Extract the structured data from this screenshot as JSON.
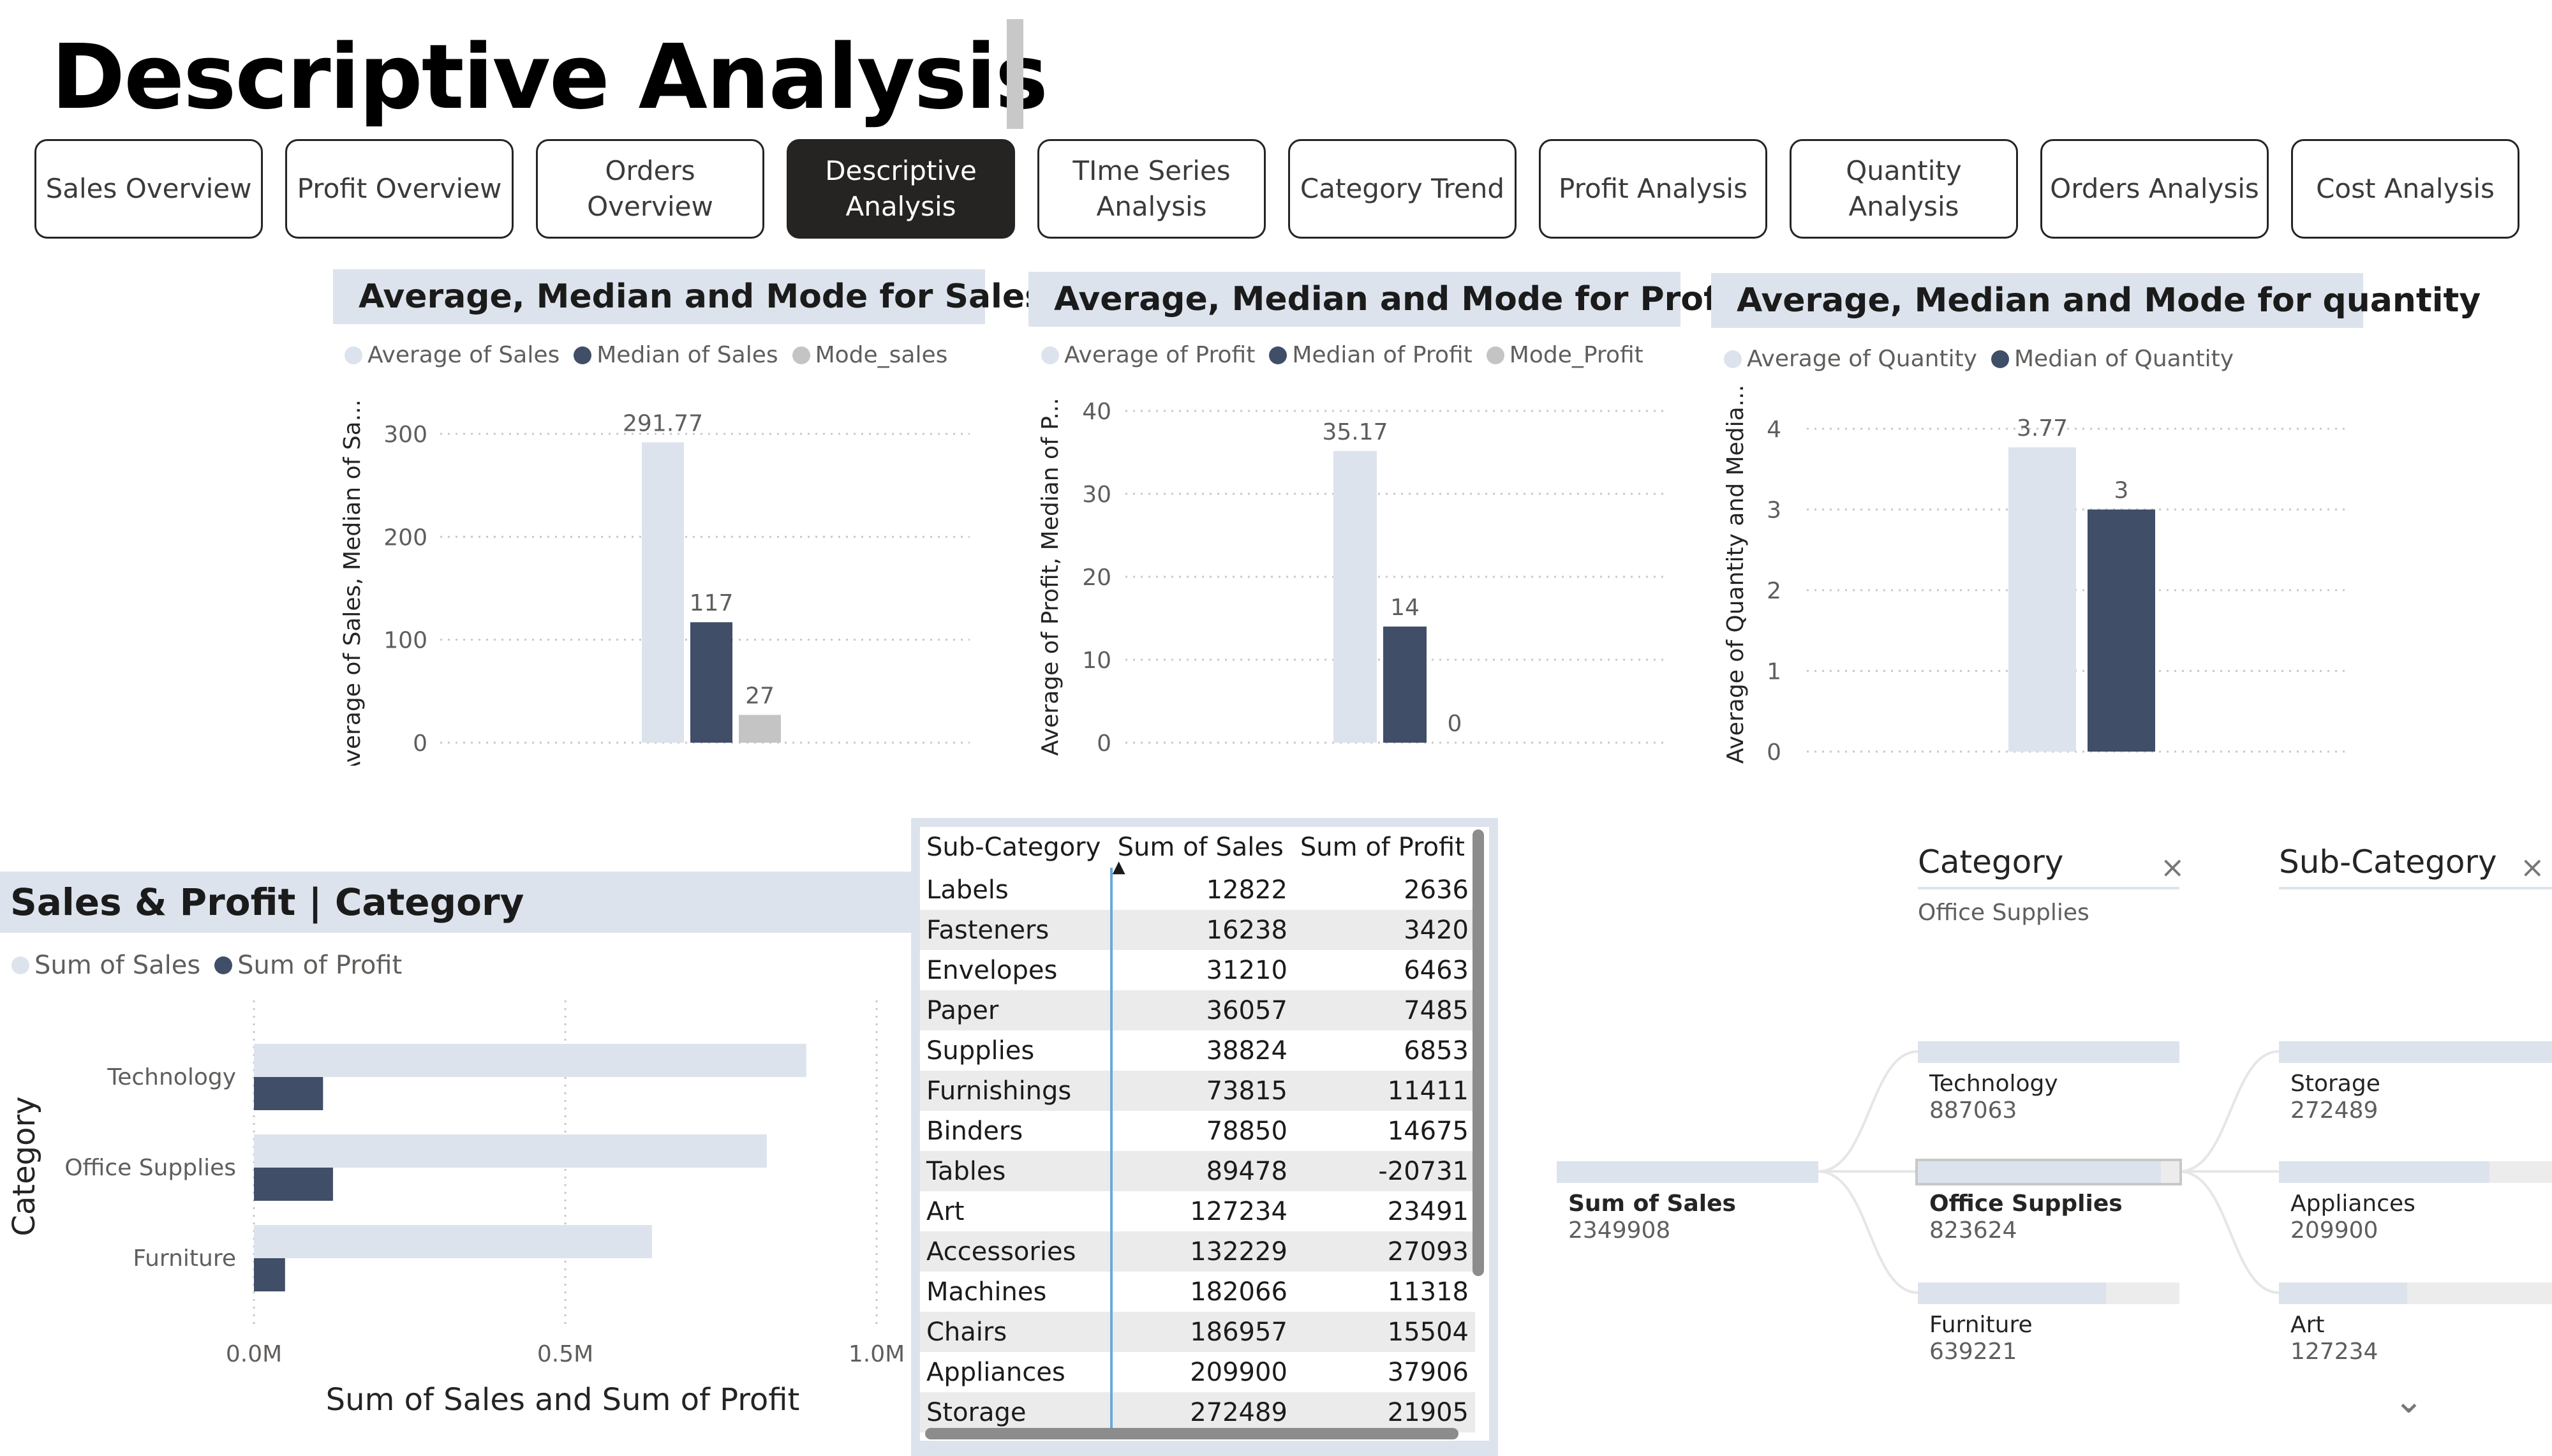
{
  "page_title": "Descriptive Analysis",
  "nav": [
    {
      "label": "Sales Overview",
      "active": false
    },
    {
      "label": "Profit Overview",
      "active": false
    },
    {
      "label": "Orders Overview",
      "active": false
    },
    {
      "label": "Descriptive Analysis",
      "active": true
    },
    {
      "label": "TIme Series Analysis",
      "active": false
    },
    {
      "label": "Category Trend",
      "active": false
    },
    {
      "label": "Profit Analysis",
      "active": false
    },
    {
      "label": "Quantity Analysis",
      "active": false
    },
    {
      "label": "Orders Analysis",
      "active": false
    },
    {
      "label": "Cost Analysis",
      "active": false
    }
  ],
  "colors": {
    "light": "#dde3ec",
    "dark": "#404e67",
    "gray": "#c4c4c4",
    "accent_line": "#6aa9d8"
  },
  "chart_data": [
    {
      "type": "bar",
      "title": "Average, Median and Mode for Sales",
      "ylabel": "Average of Sales, Median of Sa...",
      "ylim": [
        0,
        300
      ],
      "yticks": [
        "0",
        "100",
        "200",
        "300"
      ],
      "series": [
        {
          "name": "Average of Sales",
          "values": [
            291.77
          ],
          "label": "291.77"
        },
        {
          "name": "Median of Sales",
          "values": [
            117
          ],
          "label": "117"
        },
        {
          "name": "Mode_sales",
          "values": [
            27
          ],
          "label": "27"
        }
      ],
      "grid": true,
      "legend": "top-left"
    },
    {
      "type": "bar",
      "title": "Average, Median and Mode for Profits",
      "ylabel": "Average of Profit, Median of P...",
      "ylim": [
        0,
        40
      ],
      "yticks": [
        "0",
        "10",
        "20",
        "30",
        "40"
      ],
      "series": [
        {
          "name": "Average of Profit",
          "values": [
            35.17
          ],
          "label": "35.17"
        },
        {
          "name": "Median of Profit",
          "values": [
            14
          ],
          "label": "14"
        },
        {
          "name": "Mode_Profit",
          "values": [
            0
          ],
          "label": "0"
        }
      ],
      "grid": true,
      "legend": "top-left"
    },
    {
      "type": "bar",
      "title": "Average, Median and Mode for quantity",
      "ylabel": "Average of Quantity and Media...",
      "ylim": [
        0,
        4
      ],
      "yticks": [
        "0",
        "1",
        "2",
        "3",
        "4"
      ],
      "series": [
        {
          "name": "Average of Quantity",
          "values": [
            3.77
          ],
          "label": "3.77"
        },
        {
          "name": "Median of Quantity",
          "values": [
            3
          ],
          "label": "3"
        }
      ],
      "grid": true,
      "legend": "top-left"
    },
    {
      "type": "bar",
      "orientation": "horizontal",
      "title": "Sales & Profit | Category",
      "xlabel": "Sum of Sales and Sum of Profit",
      "ylabel": "Category",
      "categories": [
        "Technology",
        "Office Supplies",
        "Furniture"
      ],
      "series": [
        {
          "name": "Sum of Sales",
          "values": [
            887063,
            823624,
            639221
          ]
        },
        {
          "name": "Sum of Profit",
          "values": [
            111000,
            127000,
            50000
          ]
        }
      ],
      "xlim": [
        0,
        1000000
      ],
      "xticks": [
        "0.0M",
        "0.5M",
        "1.0M"
      ],
      "grid": true,
      "legend": "top-left"
    }
  ],
  "table": {
    "columns": [
      "Sub-Category",
      "Sum of Sales",
      "Sum of Profit"
    ],
    "rows": [
      [
        "Labels",
        "12822",
        "2636"
      ],
      [
        "Fasteners",
        "16238",
        "3420"
      ],
      [
        "Envelopes",
        "31210",
        "6463"
      ],
      [
        "Paper",
        "36057",
        "7485"
      ],
      [
        "Supplies",
        "38824",
        "6853"
      ],
      [
        "Furnishings",
        "73815",
        "11411"
      ],
      [
        "Binders",
        "78850",
        "14675"
      ],
      [
        "Tables",
        "89478",
        "-20731"
      ],
      [
        "Art",
        "127234",
        "23491"
      ],
      [
        "Accessories",
        "132229",
        "27093"
      ],
      [
        "Machines",
        "182066",
        "11318"
      ],
      [
        "Chairs",
        "186957",
        "15504"
      ],
      [
        "Appliances",
        "209900",
        "37906"
      ],
      [
        "Storage",
        "272489",
        "21905"
      ]
    ]
  },
  "tree": {
    "category_header": "Category",
    "category_selected": "Office Supplies",
    "subcategory_header": "Sub-Category",
    "root": {
      "label": "Sum of Sales",
      "value": "2349908"
    },
    "categories": [
      {
        "label": "Technology",
        "value": "887063",
        "share": 1.0
      },
      {
        "label": "Office Supplies",
        "value": "823624",
        "share": 0.93
      },
      {
        "label": "Furniture",
        "value": "639221",
        "share": 0.72
      }
    ],
    "subcategories": [
      {
        "label": "Storage",
        "value": "272489",
        "share": 1.0
      },
      {
        "label": "Appliances",
        "value": "209900",
        "share": 0.77
      },
      {
        "label": "Art",
        "value": "127234",
        "share": 0.47
      }
    ],
    "close_glyph": "×",
    "expand_glyph": "⌄"
  }
}
